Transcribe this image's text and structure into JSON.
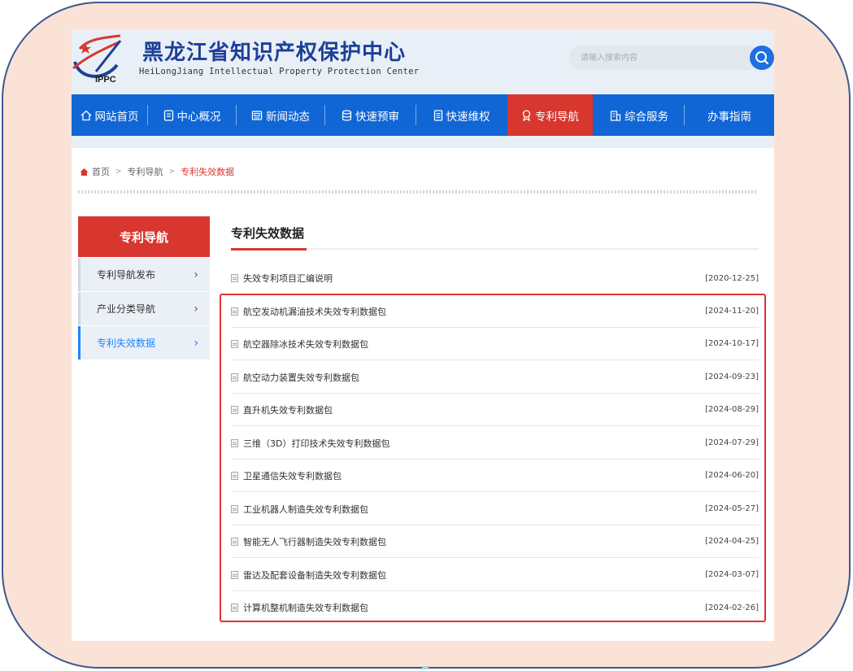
{
  "header": {
    "logo_text": "IPPC",
    "title": "黑龙江省知识产权保护中心",
    "subtitle": "HeiLongJiang Intellectual Property Protection Center",
    "search_placeholder": "请输入搜索内容",
    "search_icon": "search-icon"
  },
  "nav": {
    "items": [
      {
        "label": "网站首页",
        "icon": "home-icon"
      },
      {
        "label": "中心概况",
        "icon": "document-icon"
      },
      {
        "label": "新闻动态",
        "icon": "news-icon"
      },
      {
        "label": "快速预审",
        "icon": "database-icon"
      },
      {
        "label": "快速维权",
        "icon": "file-icon"
      },
      {
        "label": "专利导航",
        "icon": "award-icon"
      },
      {
        "label": "综合服务",
        "icon": "building-icon"
      },
      {
        "label": "办事指南",
        "icon": ""
      }
    ],
    "active_index": 5,
    "active_color": "#d8372f",
    "bar_color": "#1166d6"
  },
  "breadcrumb": {
    "home": "首页",
    "level1": "专利导航",
    "current": "专利失效数据"
  },
  "sidebar": {
    "heading": "专利导航",
    "items": [
      {
        "label": "专利导航发布"
      },
      {
        "label": "产业分类导航"
      },
      {
        "label": "专利失效数据"
      }
    ],
    "active_index": 2
  },
  "content": {
    "title": "专利失效数据",
    "rows": [
      {
        "title": "失效专利项目汇编说明",
        "date": "[2020-12-25]"
      },
      {
        "title": "航空发动机漏油技术失效专利数据包",
        "date": "[2024-11-20]"
      },
      {
        "title": "航空器除冰技术失效专利数据包",
        "date": "[2024-10-17]"
      },
      {
        "title": "航空动力装置失效专利数据包",
        "date": "[2024-09-23]"
      },
      {
        "title": "直升机失效专利数据包",
        "date": "[2024-08-29]"
      },
      {
        "title": "三维（3D）打印技术失效专利数据包",
        "date": "[2024-07-29]"
      },
      {
        "title": "卫星通信失效专利数据包",
        "date": "[2024-06-20]"
      },
      {
        "title": "工业机器人制造失效专利数据包",
        "date": "[2024-05-27]"
      },
      {
        "title": "智能无人飞行器制造失效专利数据包",
        "date": "[2024-04-25]"
      },
      {
        "title": "雷达及配套设备制造失效专利数据包",
        "date": "[2024-03-07]"
      },
      {
        "title": "计算机整机制造失效专利数据包",
        "date": "[2024-02-26]"
      }
    ]
  }
}
